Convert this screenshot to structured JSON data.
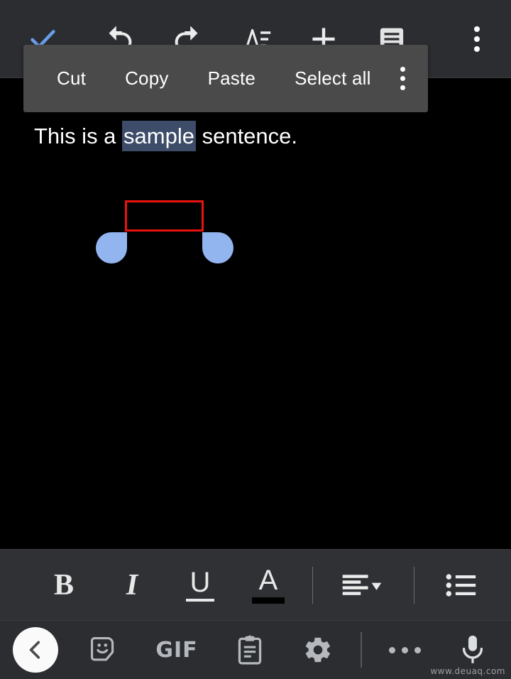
{
  "colors": {
    "top_toolbar_bg": "#2b2d31",
    "format_toolbar_bg": "#2f3135",
    "keyboard_bar_bg": "#2b2d31",
    "canvas_bg": "#000000",
    "context_menu_bg": "#4a4a4a",
    "accent_check": "#6a9de8",
    "selection_fill": "#3d4c68",
    "annotation_red": "#e8130e",
    "handle_blue": "#92b5f0",
    "icon_grey": "#e8e8e8",
    "keyboard_icon_grey": "#b5b9bd"
  },
  "top_toolbar": {
    "items": [
      {
        "name": "confirm-check-icon",
        "label": "Done"
      },
      {
        "name": "undo-icon",
        "label": "Undo"
      },
      {
        "name": "redo-icon",
        "label": "Redo"
      },
      {
        "name": "text-format-icon",
        "label": "Format"
      },
      {
        "name": "plus-icon",
        "label": "Insert"
      },
      {
        "name": "document-view-icon",
        "label": "View"
      },
      {
        "name": "overflow-menu-icon",
        "label": "More options"
      }
    ]
  },
  "context_menu": {
    "items": [
      {
        "label": "Cut"
      },
      {
        "label": "Copy"
      },
      {
        "label": "Paste"
      },
      {
        "label": "Select all"
      }
    ],
    "overflow_label": "More"
  },
  "document": {
    "text_before": "This is a ",
    "selected_word": "sample",
    "text_after": " sentence.",
    "full_text": "This is a sample sentence."
  },
  "format_toolbar": {
    "bold_label": "B",
    "italic_label": "I",
    "underline_label": "U",
    "text_color_label": "A",
    "align_label": "Align",
    "list_label": "Bulleted list"
  },
  "keyboard_bar": {
    "back_label": "Back",
    "sticker_label": "Stickers",
    "gif_label": "GIF",
    "clipboard_label": "Clipboard",
    "settings_label": "Settings",
    "more_label": "More",
    "mic_label": "Voice input"
  },
  "watermark": {
    "text": "www.deuaq.com"
  }
}
